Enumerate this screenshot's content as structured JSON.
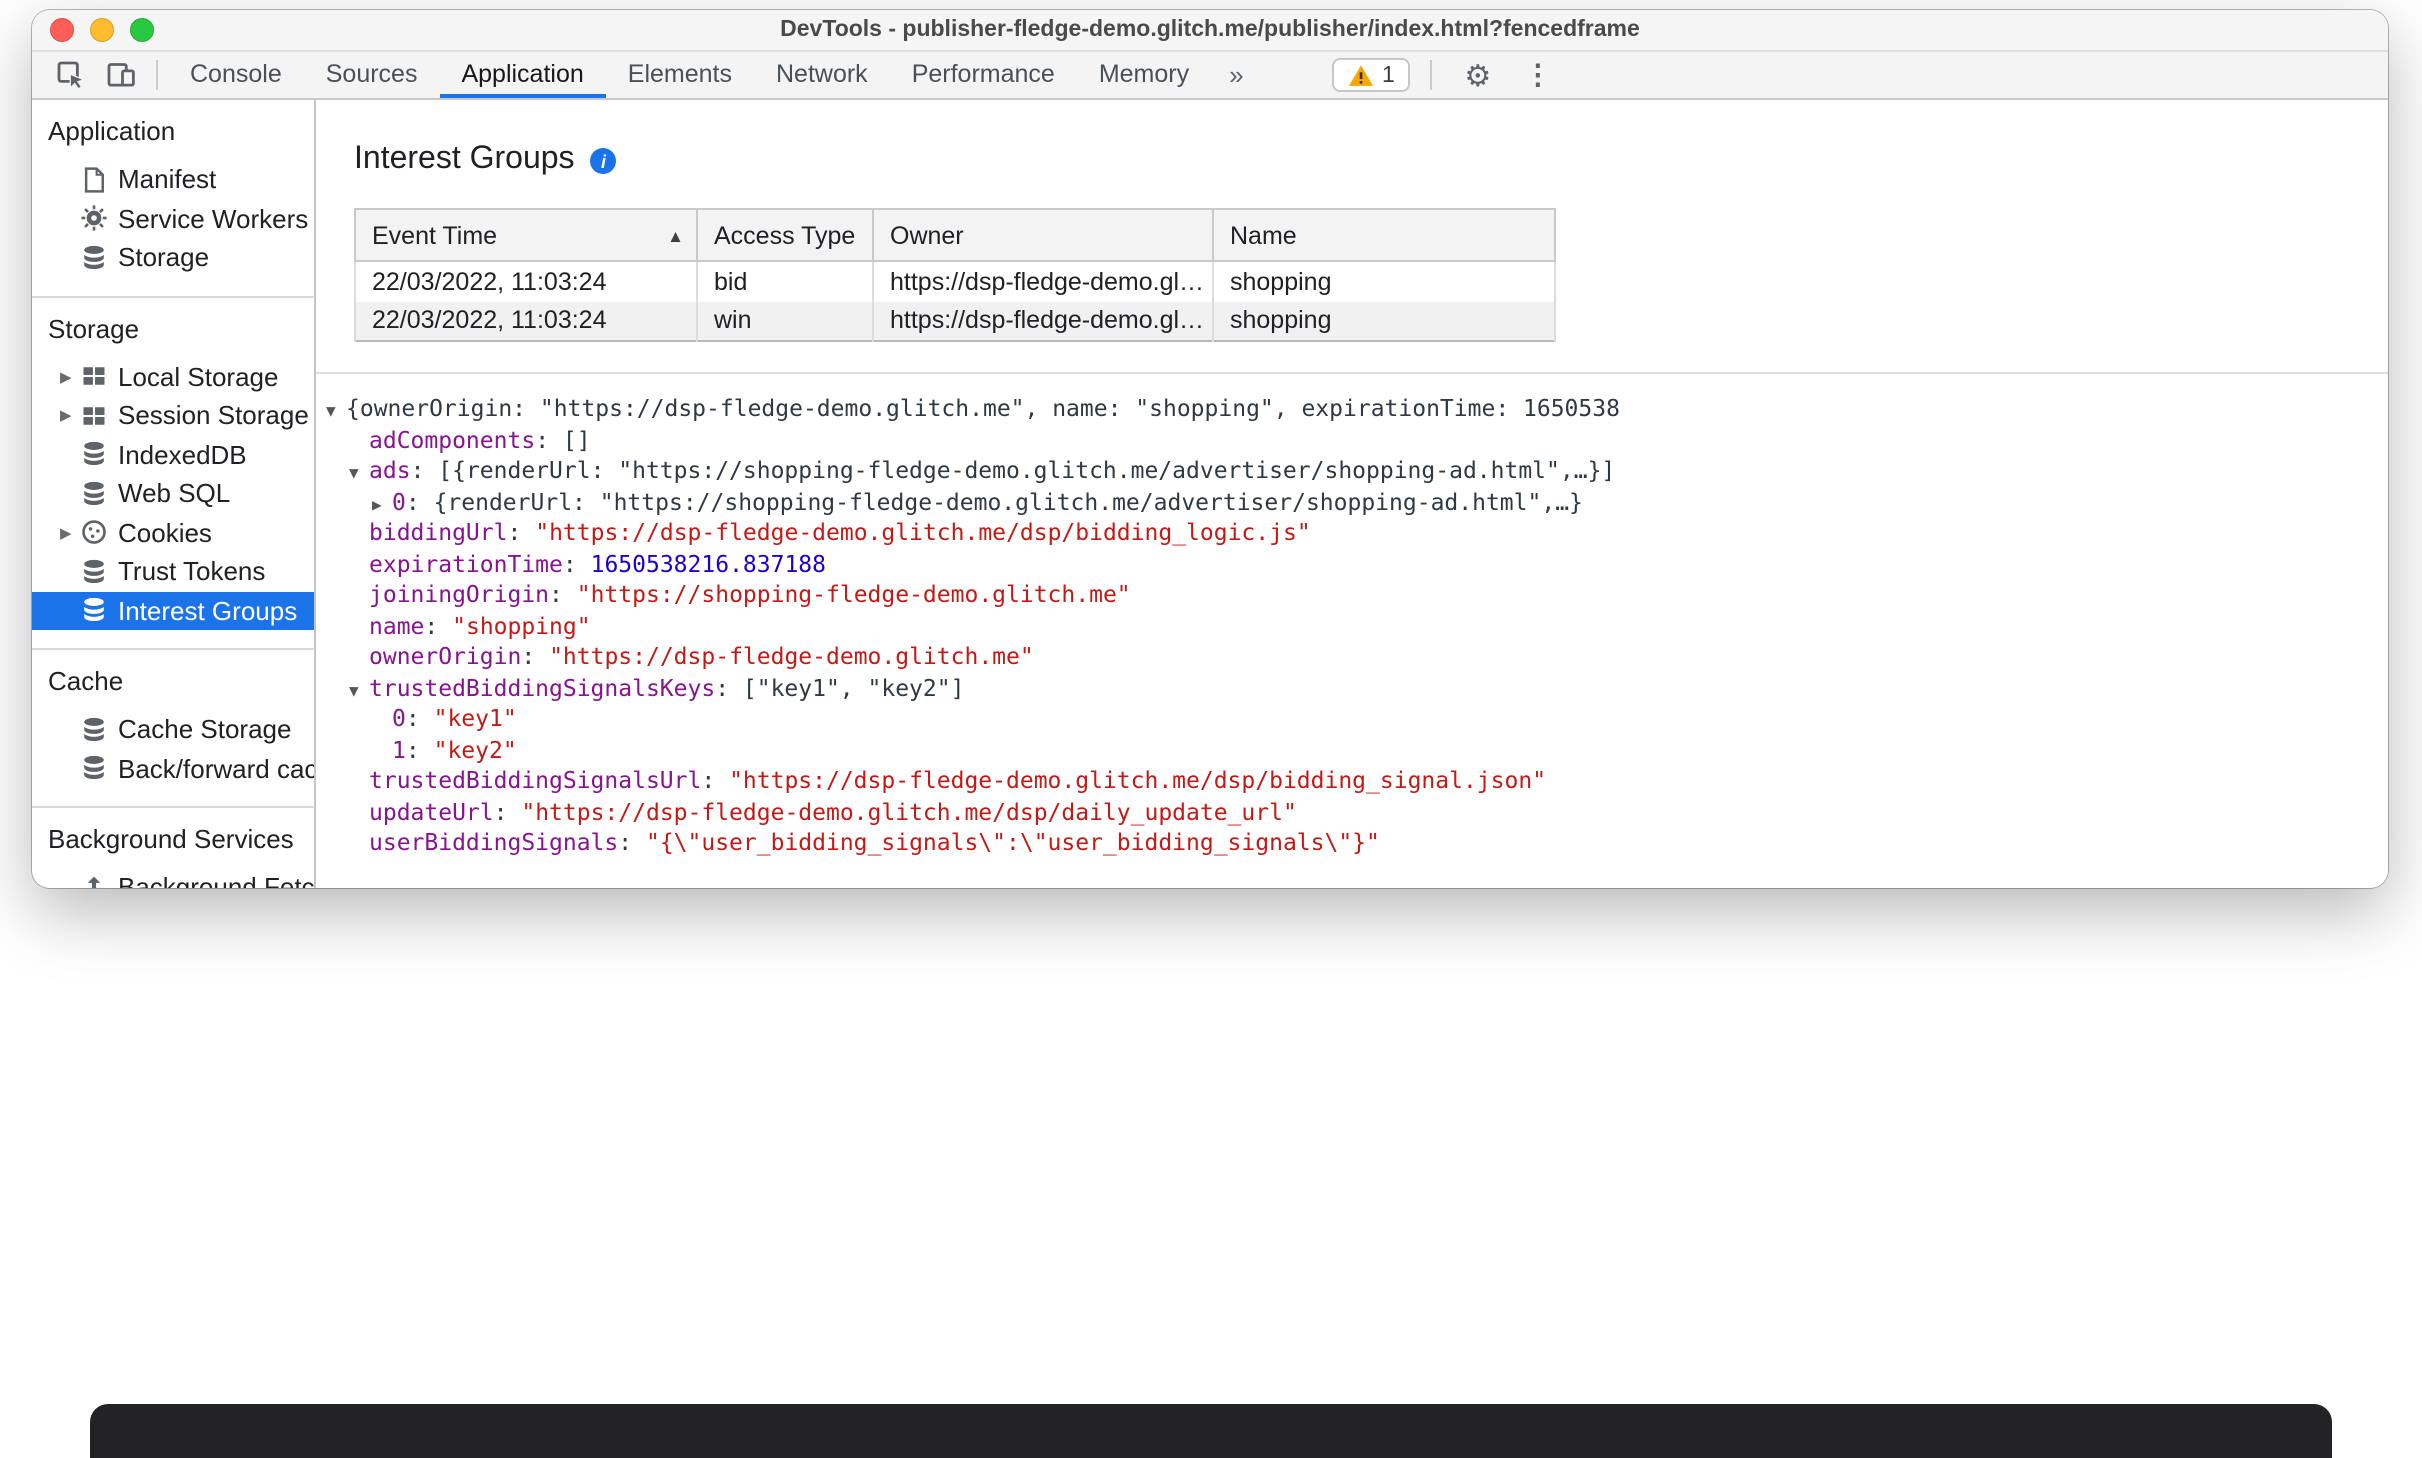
{
  "window": {
    "title": "DevTools - publisher-fledge-demo.glitch.me/publisher/index.html?fencedframe"
  },
  "colors": {
    "accent": "#1a73e8",
    "selection_background": "#1a73e8",
    "warning_yellow": "#f6a609",
    "traffic_red": "#ff5f57",
    "traffic_yellow": "#febc2e",
    "traffic_green": "#28c840",
    "json_key": "#881391",
    "json_string": "#c41a16",
    "json_number": "#1c00cf",
    "json_plain": "#303942"
  },
  "icons": {
    "more_tabs": "»",
    "settings_gear": "⚙",
    "more_options": "⋮",
    "sort_ascending": "▲",
    "tree_expanded": "▼",
    "tree_collapsed": "▶",
    "sidebar_collapsed": "▶",
    "info_glyph": "i"
  },
  "toolbar": {
    "tabs": [
      "Console",
      "Sources",
      "Application",
      "Elements",
      "Network",
      "Performance",
      "Memory"
    ],
    "active_tab": "Application",
    "warning_count": "1"
  },
  "sidebar": {
    "sections": [
      {
        "title": "Application",
        "items": [
          {
            "label": "Manifest",
            "icon": "document"
          },
          {
            "label": "Service Workers",
            "icon": "gear"
          },
          {
            "label": "Storage",
            "icon": "database"
          }
        ]
      },
      {
        "title": "Storage",
        "items": [
          {
            "label": "Local Storage",
            "icon": "table",
            "expandable": true
          },
          {
            "label": "Session Storage",
            "icon": "table",
            "expandable": true
          },
          {
            "label": "IndexedDB",
            "icon": "database"
          },
          {
            "label": "Web SQL",
            "icon": "database"
          },
          {
            "label": "Cookies",
            "icon": "cookie",
            "expandable": true
          },
          {
            "label": "Trust Tokens",
            "icon": "database"
          },
          {
            "label": "Interest Groups",
            "icon": "database",
            "selected": true
          }
        ]
      },
      {
        "title": "Cache",
        "items": [
          {
            "label": "Cache Storage",
            "icon": "database"
          },
          {
            "label": "Back/forward cach",
            "icon": "database"
          }
        ]
      },
      {
        "title": "Background Services",
        "items": [
          {
            "label": "Background Fetch",
            "icon": "fetch"
          }
        ]
      }
    ]
  },
  "main": {
    "heading": "Interest Groups",
    "table": {
      "columns": [
        "Event Time",
        "Access Type",
        "Owner",
        "Name"
      ],
      "sort": {
        "column": "Event Time",
        "direction": "ascending"
      },
      "rows": [
        [
          "22/03/2022, 11:03:24",
          "bid",
          "https://dsp-fledge-demo.gl…",
          "shopping"
        ],
        [
          "22/03/2022, 11:03:24",
          "win",
          "https://dsp-fledge-demo.gl…",
          "shopping"
        ]
      ]
    },
    "tree": {
      "lines": [
        {
          "indent": 0,
          "arrow": "expanded",
          "segments": [
            {
              "text": "{ownerOrigin: \"https://dsp-fledge-demo.glitch.me\", name: \"shopping\", expirationTime: 1650538",
              "type": "plain"
            }
          ]
        },
        {
          "indent": 1,
          "arrow": "none",
          "segments": [
            {
              "text": "adComponents",
              "type": "key"
            },
            {
              "text": ": []",
              "type": "plain"
            }
          ]
        },
        {
          "indent": 1,
          "arrow": "expanded",
          "segments": [
            {
              "text": "ads",
              "type": "key"
            },
            {
              "text": ": [{renderUrl: \"https://shopping-fledge-demo.glitch.me/advertiser/shopping-ad.html\",…}]",
              "type": "plain"
            }
          ]
        },
        {
          "indent": 2,
          "arrow": "collapsed",
          "segments": [
            {
              "text": "0",
              "type": "key"
            },
            {
              "text": ": {renderUrl: \"https://shopping-fledge-demo.glitch.me/advertiser/shopping-ad.html\",…}",
              "type": "plain"
            }
          ]
        },
        {
          "indent": 1,
          "arrow": "none",
          "segments": [
            {
              "text": "biddingUrl",
              "type": "key"
            },
            {
              "text": ": ",
              "type": "plain"
            },
            {
              "text": "\"https://dsp-fledge-demo.glitch.me/dsp/bidding_logic.js\"",
              "type": "string"
            }
          ]
        },
        {
          "indent": 1,
          "arrow": "none",
          "segments": [
            {
              "text": "expirationTime",
              "type": "key"
            },
            {
              "text": ": ",
              "type": "plain"
            },
            {
              "text": "1650538216.837188",
              "type": "number"
            }
          ]
        },
        {
          "indent": 1,
          "arrow": "none",
          "segments": [
            {
              "text": "joiningOrigin",
              "type": "key"
            },
            {
              "text": ": ",
              "type": "plain"
            },
            {
              "text": "\"https://shopping-fledge-demo.glitch.me\"",
              "type": "string"
            }
          ]
        },
        {
          "indent": 1,
          "arrow": "none",
          "segments": [
            {
              "text": "name",
              "type": "key"
            },
            {
              "text": ": ",
              "type": "plain"
            },
            {
              "text": "\"shopping\"",
              "type": "string"
            }
          ]
        },
        {
          "indent": 1,
          "arrow": "none",
          "segments": [
            {
              "text": "ownerOrigin",
              "type": "key"
            },
            {
              "text": ": ",
              "type": "plain"
            },
            {
              "text": "\"https://dsp-fledge-demo.glitch.me\"",
              "type": "string"
            }
          ]
        },
        {
          "indent": 1,
          "arrow": "expanded",
          "segments": [
            {
              "text": "trustedBiddingSignalsKeys",
              "type": "key"
            },
            {
              "text": ": [\"key1\", \"key2\"]",
              "type": "plain"
            }
          ]
        },
        {
          "indent": 2,
          "arrow": "none",
          "segments": [
            {
              "text": "0",
              "type": "key"
            },
            {
              "text": ": ",
              "type": "plain"
            },
            {
              "text": "\"key1\"",
              "type": "string"
            }
          ]
        },
        {
          "indent": 2,
          "arrow": "none",
          "segments": [
            {
              "text": "1",
              "type": "key"
            },
            {
              "text": ": ",
              "type": "plain"
            },
            {
              "text": "\"key2\"",
              "type": "string"
            }
          ]
        },
        {
          "indent": 1,
          "arrow": "none",
          "segments": [
            {
              "text": "trustedBiddingSignalsUrl",
              "type": "key"
            },
            {
              "text": ": ",
              "type": "plain"
            },
            {
              "text": "\"https://dsp-fledge-demo.glitch.me/dsp/bidding_signal.json\"",
              "type": "string"
            }
          ]
        },
        {
          "indent": 1,
          "arrow": "none",
          "segments": [
            {
              "text": "updateUrl",
              "type": "key"
            },
            {
              "text": ": ",
              "type": "plain"
            },
            {
              "text": "\"https://dsp-fledge-demo.glitch.me/dsp/daily_update_url\"",
              "type": "string"
            }
          ]
        },
        {
          "indent": 1,
          "arrow": "none",
          "segments": [
            {
              "text": "userBiddingSignals",
              "type": "key"
            },
            {
              "text": ": ",
              "type": "plain"
            },
            {
              "text": "\"{\\\"user_bidding_signals\\\":\\\"user_bidding_signals\\\"}\"",
              "type": "string"
            }
          ]
        }
      ]
    }
  }
}
